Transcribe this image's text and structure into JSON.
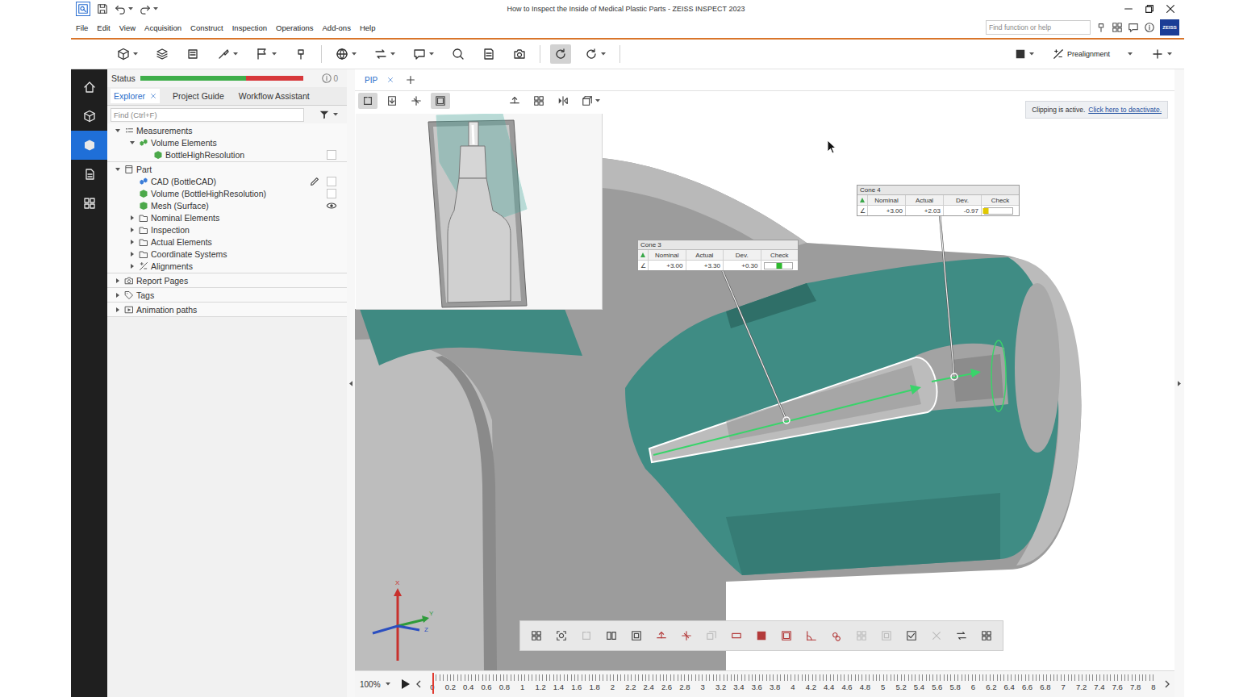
{
  "window": {
    "title": "How to Inspect the Inside of Medical Plastic Parts - ZEISS INSPECT 2023"
  },
  "menu": [
    "File",
    "Edit",
    "View",
    "Acquisition",
    "Construct",
    "Inspection",
    "Operations",
    "Add-ons",
    "Help"
  ],
  "search": {
    "placeholder": "Find function or help"
  },
  "logo": "ZEISS",
  "toolbar": {
    "buttons": [
      {
        "selected": false
      },
      {
        "selected": false
      },
      {
        "selected": false
      },
      {
        "selected": false
      },
      {
        "selected": false
      },
      {
        "selected": false
      },
      {
        "selected": false
      },
      {
        "selected": false
      },
      {
        "selected": false
      },
      {
        "selected": false
      },
      {
        "selected": false
      },
      {
        "selected": false
      },
      {
        "selected": true
      },
      {
        "selected": false
      }
    ],
    "alignment": "Prealignment"
  },
  "rail": [
    {
      "selected": false
    },
    {
      "selected": false
    },
    {
      "selected": true
    },
    {
      "selected": false
    },
    {
      "selected": false
    }
  ],
  "status": {
    "label": "Status",
    "level": 0.65,
    "messages": "0"
  },
  "panel_tabs": [
    {
      "label": "Explorer",
      "selected": true,
      "closable": true
    },
    {
      "label": "Project Guide",
      "selected": false,
      "closable": false
    },
    {
      "label": "Workflow Assistant",
      "selected": false,
      "closable": false
    }
  ],
  "find": {
    "placeholder": "Find (Ctrl+F)"
  },
  "tree": [
    [
      {
        "label": "Measurements",
        "kind": "measurements",
        "depth": 0,
        "leaf": false,
        "expanded": true,
        "toggle": false,
        "visible": false,
        "editing": false
      },
      {
        "label": "Volume Elements",
        "kind": "group",
        "depth": 1,
        "leaf": false,
        "expanded": true,
        "toggle": false,
        "visible": false,
        "editing": false
      },
      {
        "label": "BottleHighResolution",
        "kind": "volume",
        "depth": 2,
        "leaf": true,
        "expanded": false,
        "toggle": true,
        "visible": false,
        "editing": false
      }
    ],
    [
      {
        "label": "Part",
        "kind": "part",
        "depth": 0,
        "leaf": false,
        "expanded": true,
        "toggle": false,
        "visible": false,
        "editing": false
      },
      {
        "label": "CAD (BottleCAD)",
        "kind": "cad",
        "depth": 1,
        "leaf": true,
        "expanded": false,
        "toggle": true,
        "visible": false,
        "editing": true
      },
      {
        "label": "Volume (BottleHighResolution)",
        "kind": "volume",
        "depth": 1,
        "leaf": true,
        "expanded": false,
        "toggle": true,
        "visible": false,
        "editing": false
      },
      {
        "label": "Mesh (Surface)",
        "kind": "mesh",
        "depth": 1,
        "leaf": true,
        "expanded": false,
        "toggle": true,
        "visible": true,
        "editing": false
      },
      {
        "label": "Nominal Elements",
        "kind": "folder",
        "depth": 1,
        "leaf": false,
        "expanded": false,
        "toggle": false,
        "visible": false,
        "editing": false
      },
      {
        "label": "Inspection",
        "kind": "folder",
        "depth": 1,
        "leaf": false,
        "expanded": false,
        "toggle": false,
        "visible": false,
        "editing": false
      },
      {
        "label": "Actual Elements",
        "kind": "folder",
        "depth": 1,
        "leaf": false,
        "expanded": false,
        "toggle": false,
        "visible": false,
        "editing": false
      },
      {
        "label": "Coordinate Systems",
        "kind": "folder",
        "depth": 1,
        "leaf": false,
        "expanded": false,
        "toggle": false,
        "visible": false,
        "editing": false
      },
      {
        "label": "Alignments",
        "kind": "alignment",
        "depth": 1,
        "leaf": false,
        "expanded": false,
        "toggle": false,
        "visible": false,
        "editing": false
      }
    ],
    [
      {
        "label": "Report Pages",
        "kind": "report",
        "depth": 0,
        "leaf": false,
        "expanded": false,
        "toggle": false,
        "visible": false,
        "editing": false
      }
    ],
    [
      {
        "label": "Tags",
        "kind": "tag",
        "depth": 0,
        "leaf": false,
        "expanded": false,
        "toggle": false,
        "visible": false,
        "editing": false
      }
    ],
    [
      {
        "label": "Animation paths",
        "kind": "animation",
        "depth": 0,
        "leaf": false,
        "expanded": false,
        "toggle": false,
        "visible": false,
        "editing": false
      }
    ]
  ],
  "viewport": {
    "tabs": [
      {
        "label": "PIP",
        "selected": true
      }
    ],
    "tools": [
      {
        "selected": true
      },
      {
        "selected": false
      },
      {
        "selected": false
      },
      {
        "selected": true
      },
      {
        "selected": false
      },
      {
        "selected": false
      },
      {
        "selected": false
      },
      {
        "selected": false
      }
    ],
    "clipping": {
      "text": "Clipping is active.",
      "link": "Click here to deactivate."
    }
  },
  "callouts": [
    {
      "title": "Cone 3",
      "columns": [
        "Nominal",
        "Actual",
        "Dev.",
        "Check"
      ],
      "symbol": "∠",
      "nominal": "+3.00",
      "actual": "+3.30",
      "deviation": "+0.30",
      "level": 0.55,
      "color": "#2db82d"
    },
    {
      "title": "Cone 4",
      "columns": [
        "Nominal",
        "Actual",
        "Dev.",
        "Check"
      ],
      "symbol": "∠",
      "nominal": "+3.00",
      "actual": "+2.03",
      "deviation": "-0.97",
      "level": 0.04,
      "color": "#e0c800"
    }
  ],
  "axes": [
    "X",
    "Y",
    "Z"
  ],
  "bottom_tools": [
    {
      "disabled": false
    },
    {
      "disabled": false
    },
    {
      "disabled": true
    },
    {
      "disabled": false
    },
    {
      "disabled": false
    },
    {
      "disabled": false
    },
    {
      "disabled": false
    },
    {
      "disabled": true
    },
    {
      "disabled": false
    },
    {
      "disabled": false
    },
    {
      "disabled": false
    },
    {
      "disabled": false
    },
    {
      "disabled": false
    },
    {
      "disabled": true
    },
    {
      "disabled": true
    },
    {
      "disabled": false
    },
    {
      "disabled": true
    },
    {
      "disabled": false
    },
    {
      "disabled": false
    }
  ],
  "timeline": {
    "zoom": "100%",
    "level": 0,
    "ticks": [
      "0",
      "0.2",
      "0.4",
      "0.6",
      "0.8",
      "1",
      "1.2",
      "1.4",
      "1.6",
      "1.8",
      "2",
      "2.2",
      "2.4",
      "2.6",
      "2.8",
      "3",
      "3.2",
      "3.4",
      "3.6",
      "3.8",
      "4",
      "4.2",
      "4.4",
      "4.6",
      "4.8",
      "5",
      "5.2",
      "5.4",
      "5.6",
      "5.8",
      "6",
      "6.2",
      "6.4",
      "6.6",
      "6.8",
      "7",
      "7.2",
      "7.4",
      "7.6",
      "7.8",
      "8"
    ]
  }
}
